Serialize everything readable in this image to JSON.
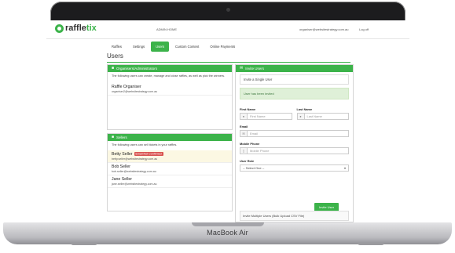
{
  "device": {
    "label": "MacBook Air"
  },
  "header": {
    "logo_prefix": "raffle",
    "logo_suffix": "tix",
    "admin_home": "ADMIN HOME",
    "user_email": "organiser@websitestrategy.com.au",
    "logout": "Log off"
  },
  "tabs": [
    {
      "label": "Raffles",
      "active": false
    },
    {
      "label": "Settings",
      "active": false
    },
    {
      "label": "Users",
      "active": true
    },
    {
      "label": "Custom Content",
      "active": false
    },
    {
      "label": "Online Payments",
      "active": false
    }
  ],
  "page": {
    "title": "Users"
  },
  "organisers": {
    "heading": "Organisers/Administrators",
    "description": "The following users can create, manage and close raffles, as well as pick the winners.",
    "people": [
      {
        "name": "Raffle Organiser",
        "email": "organiser2@websitestrategy.com.au"
      }
    ]
  },
  "sellers": {
    "heading": "Sellers",
    "description": "The following users can sell tickets in your raffles.",
    "people": [
      {
        "name": "Betty Seller",
        "email": "betty.seller@websitestrategy.com.au",
        "badge": "Email Not Confirmed"
      },
      {
        "name": "Bob Seller",
        "email": "bob.seller@websitestrategy.com.au"
      },
      {
        "name": "Jane Seller",
        "email": "jane.seller@websitestrategy.com.au"
      }
    ]
  },
  "invite": {
    "heading": "Invite Users",
    "single_label": "Invite a Single User",
    "success_message": "User has been invited",
    "first_name_label": "First Name",
    "first_name_placeholder": "First Name",
    "last_name_label": "Last Name",
    "last_name_placeholder": "Last Name",
    "email_label": "Email",
    "email_placeholder": "Email",
    "phone_label": "Mobile Phone",
    "phone_placeholder": "Mobile Phone",
    "role_label": "User Role",
    "role_selected": "-- Select One --",
    "submit_label": "Invite User",
    "bulk_label": "Invite Multiple Users (Bulk Upload CSV File)"
  },
  "colors": {
    "accent": "#3cb34a",
    "danger": "#d9534f"
  }
}
